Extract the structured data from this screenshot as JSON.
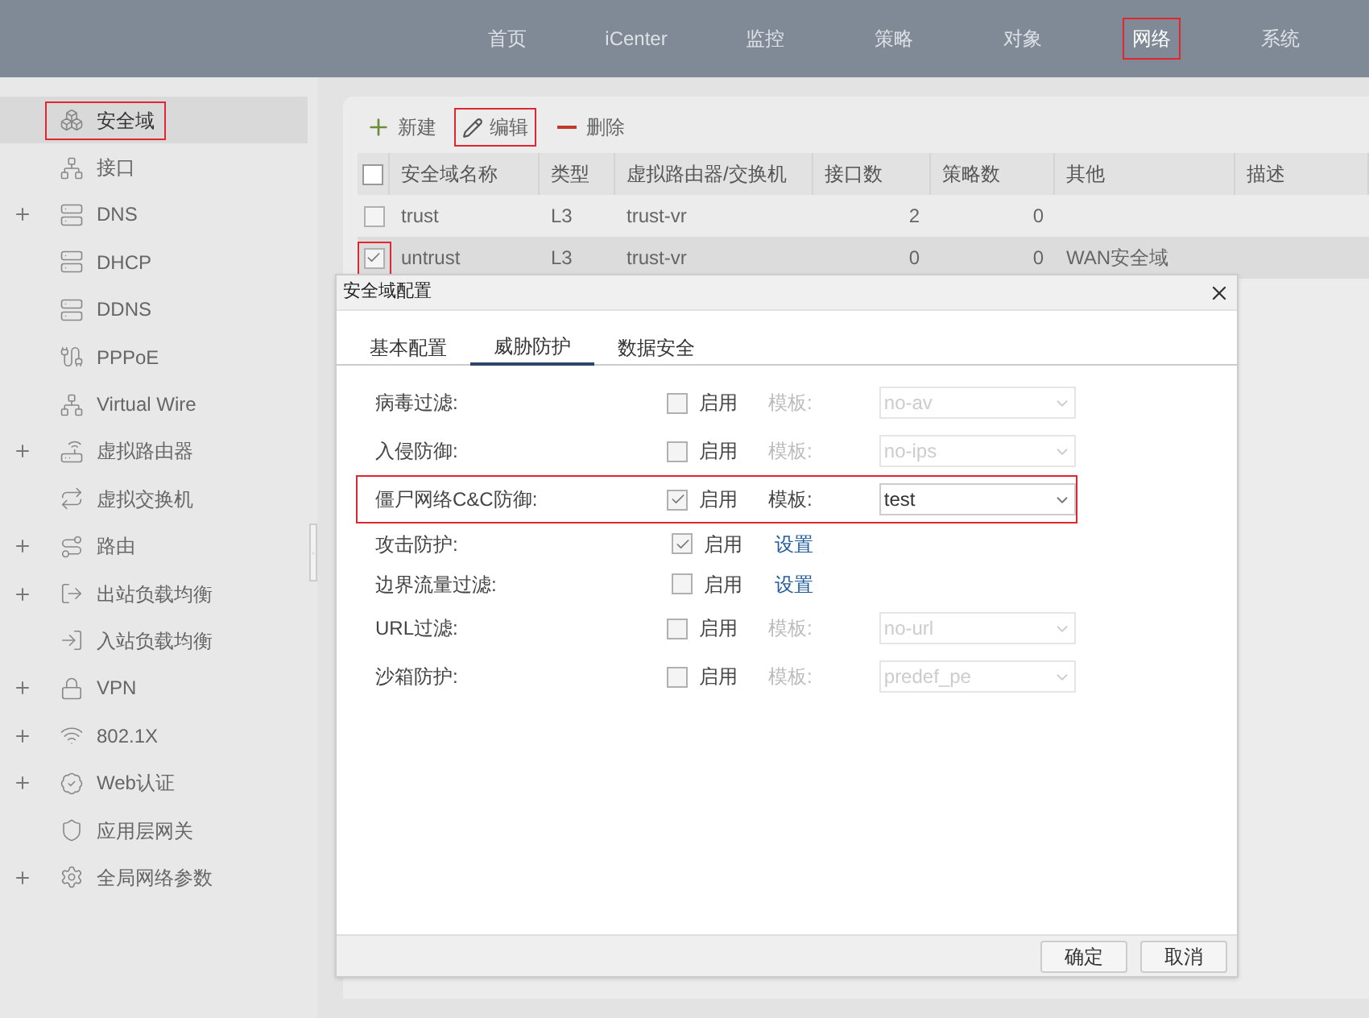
{
  "top_nav": [
    {
      "label": "首页",
      "selected": false,
      "highlighted": false
    },
    {
      "label": "iCenter",
      "selected": false,
      "highlighted": false
    },
    {
      "label": "监控",
      "selected": false,
      "highlighted": false
    },
    {
      "label": "策略",
      "selected": false,
      "highlighted": false
    },
    {
      "label": "对象",
      "selected": false,
      "highlighted": false
    },
    {
      "label": "网络",
      "selected": true,
      "highlighted": true
    },
    {
      "label": "系统",
      "selected": false,
      "highlighted": false
    }
  ],
  "sidebar": {
    "items": [
      {
        "label": "安全域",
        "kind": "leaf",
        "selected": true,
        "highlighted": true
      },
      {
        "label": "接口",
        "kind": "leaf",
        "selected": false,
        "highlighted": false
      },
      {
        "label": "DNS",
        "kind": "group",
        "selected": false,
        "highlighted": false
      },
      {
        "label": "DHCP",
        "kind": "leaf",
        "selected": false,
        "highlighted": false
      },
      {
        "label": "DDNS",
        "kind": "leaf",
        "selected": false,
        "highlighted": false
      },
      {
        "label": "PPPoE",
        "kind": "leaf",
        "selected": false,
        "highlighted": false
      },
      {
        "label": "Virtual Wire",
        "kind": "leaf",
        "selected": false,
        "highlighted": false
      },
      {
        "label": "虚拟路由器",
        "kind": "group",
        "selected": false,
        "highlighted": false
      },
      {
        "label": "虚拟交换机",
        "kind": "leaf",
        "selected": false,
        "highlighted": false
      },
      {
        "label": "路由",
        "kind": "group",
        "selected": false,
        "highlighted": false
      },
      {
        "label": "出站负载均衡",
        "kind": "group",
        "selected": false,
        "highlighted": false
      },
      {
        "label": "入站负载均衡",
        "kind": "leaf",
        "selected": false,
        "highlighted": false
      },
      {
        "label": "VPN",
        "kind": "group",
        "selected": false,
        "highlighted": false
      },
      {
        "label": "802.1X",
        "kind": "group",
        "selected": false,
        "highlighted": false
      },
      {
        "label": "Web认证",
        "kind": "group",
        "selected": false,
        "highlighted": false
      },
      {
        "label": "应用层网关",
        "kind": "leaf",
        "selected": false,
        "highlighted": false
      },
      {
        "label": "全局网络参数",
        "kind": "group",
        "selected": false,
        "highlighted": false
      }
    ]
  },
  "toolbar": [
    {
      "label": "新建",
      "kind": "add",
      "highlighted": false
    },
    {
      "label": "编辑",
      "kind": "edit",
      "highlighted": true
    },
    {
      "label": "删除",
      "kind": "delete",
      "highlighted": false
    }
  ],
  "table": {
    "all_checked": false,
    "columns": [
      "安全域名称",
      "类型",
      "虚拟路由器/交换机",
      "接口数",
      "策略数",
      "其他",
      "描述"
    ],
    "rows": [
      {
        "cells": [
          "trust",
          "L3",
          "trust-vr",
          "2",
          "0",
          ""
        ],
        "selected": false,
        "highlighted": false
      },
      {
        "cells": [
          "untrust",
          "L3",
          "trust-vr",
          "0",
          "0",
          "WAN安全域"
        ],
        "selected": true,
        "highlighted": true
      }
    ]
  },
  "dialog": {
    "title": "安全域配置",
    "tabs": [
      {
        "label": "基本配置",
        "selected": false
      },
      {
        "label": "威胁防护",
        "selected": true
      },
      {
        "label": "数据安全",
        "selected": false
      }
    ],
    "rows": [
      {
        "label": "病毒过滤:",
        "kind": "template",
        "checked": false,
        "enable_label": "启用",
        "template_label": "模板:",
        "value": "no-av",
        "highlighted": false
      },
      {
        "label": "入侵防御:",
        "kind": "template",
        "checked": false,
        "enable_label": "启用",
        "template_label": "模板:",
        "value": "no-ips",
        "highlighted": false
      },
      {
        "label": "僵尸网络C&C防御:",
        "kind": "template",
        "checked": true,
        "enable_label": "启用",
        "template_label": "模板:",
        "value": "test",
        "highlighted": true
      },
      {
        "label": "攻击防护:",
        "kind": "settings",
        "checked": true,
        "enable_label": "启用",
        "link": "设置",
        "highlighted": false
      },
      {
        "label": "边界流量过滤:",
        "kind": "settings",
        "checked": false,
        "enable_label": "启用",
        "link": "设置",
        "highlighted": false
      },
      {
        "label": "URL过滤:",
        "kind": "template",
        "checked": false,
        "enable_label": "启用",
        "template_label": "模板:",
        "value": "no-url",
        "highlighted": false
      },
      {
        "label": "沙箱防护:",
        "kind": "template",
        "checked": false,
        "enable_label": "启用",
        "template_label": "模板:",
        "value": "predef_pe",
        "highlighted": false
      }
    ],
    "buttons": [
      "确定",
      "取消"
    ]
  }
}
